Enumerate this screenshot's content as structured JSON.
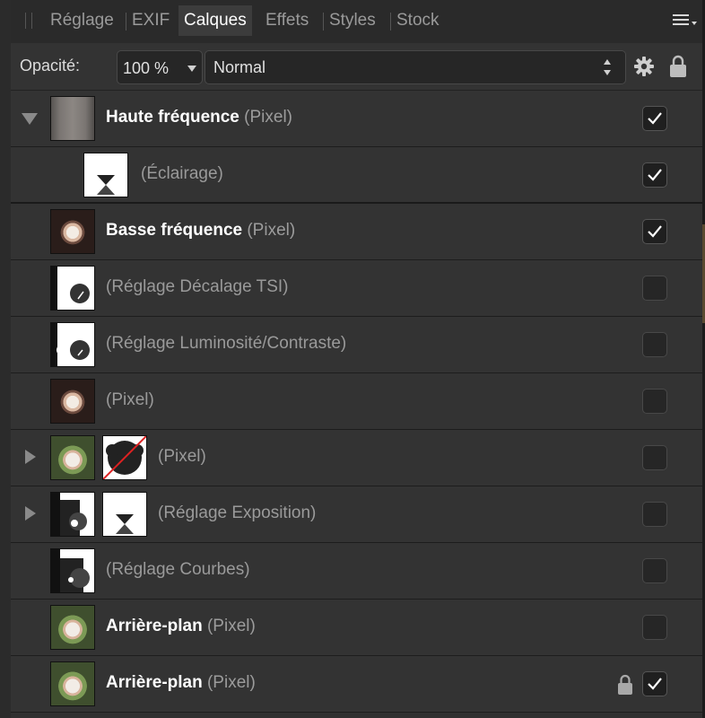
{
  "tabs": [
    {
      "label": "Réglage",
      "active": false
    },
    {
      "label": "EXIF",
      "active": false
    },
    {
      "label": "Calques",
      "active": true
    },
    {
      "label": "Effets",
      "active": false
    },
    {
      "label": "Styles",
      "active": false
    },
    {
      "label": "Stock",
      "active": false
    }
  ],
  "toolbar": {
    "opacity_label": "Opacité:",
    "opacity_value": "100 %",
    "blend_mode": "Normal"
  },
  "layers": [
    {
      "name": "Haute fréquence",
      "type": "(Pixel)",
      "bold": true,
      "expanded": true,
      "visible": true,
      "thumb": "blur-gray"
    },
    {
      "name": "",
      "type": "(Éclairage)",
      "bold": false,
      "child": true,
      "visible": true,
      "thumb": "levels-white"
    },
    {
      "name": "Basse fréquence",
      "type": "(Pixel)",
      "bold": true,
      "visible": true,
      "thumb": "flower-dark"
    },
    {
      "name": "",
      "type": "(Réglage Décalage TSI)",
      "bold": false,
      "visible": false,
      "thumb": "mask-hsl"
    },
    {
      "name": "",
      "type": "(Réglage Luminosité/Contraste)",
      "bold": false,
      "visible": false,
      "thumb": "mask-bc"
    },
    {
      "name": "",
      "type": "(Pixel)",
      "bold": false,
      "visible": false,
      "thumb": "flower-dark"
    },
    {
      "name": "",
      "type": "(Pixel)",
      "bold": false,
      "collapsed": true,
      "visible": false,
      "thumb": "flower-green",
      "mask": "mask-crossed"
    },
    {
      "name": "",
      "type": "(Réglage Exposition)",
      "bold": false,
      "collapsed": true,
      "visible": false,
      "thumb": "mask-exposure",
      "mask": "levels-white"
    },
    {
      "name": "",
      "type": "(Réglage Courbes)",
      "bold": false,
      "visible": false,
      "thumb": "mask-curves"
    },
    {
      "name": "Arrière-plan",
      "type": "(Pixel)",
      "bold": true,
      "visible": false,
      "thumb": "flower-green"
    },
    {
      "name": "Arrière-plan",
      "type": "(Pixel)",
      "bold": true,
      "visible": true,
      "locked": true,
      "thumb": "flower-green"
    }
  ],
  "colors": {
    "panel": "#303030",
    "row": "#333333",
    "text_bold": "#ffffff",
    "text_dim": "#9a9a9a"
  },
  "icons": [
    "grip-icon",
    "panel-menu-icon",
    "gear-icon",
    "lock-icon",
    "check-icon",
    "expand-triangle-icon",
    "collapse-triangle-icon"
  ]
}
